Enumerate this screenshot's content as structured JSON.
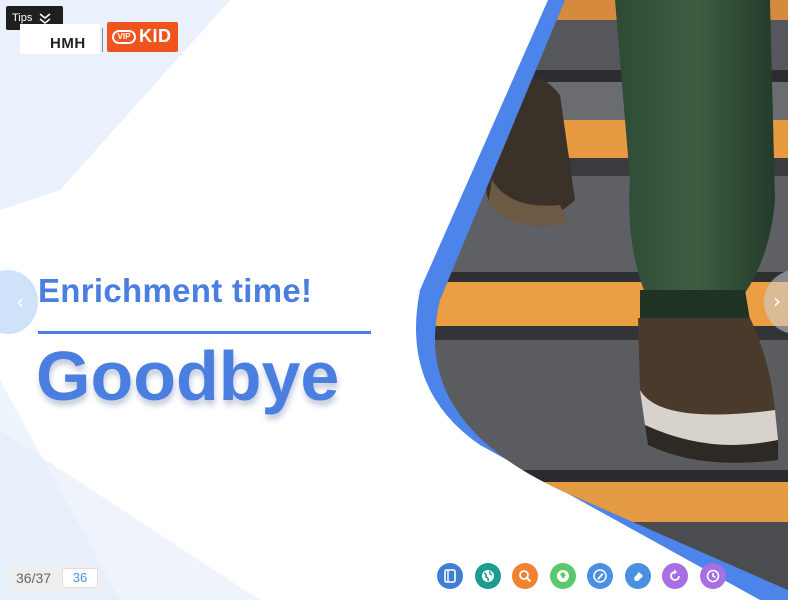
{
  "tips": {
    "label": "Tips"
  },
  "logos": {
    "hmh": "HMH",
    "vip": "VIP",
    "kid": "KID"
  },
  "slide": {
    "subtitle": "Enrichment time!",
    "title": "Goodbye"
  },
  "pagination": {
    "count": "36/37",
    "current": "36"
  },
  "toolbar": {
    "tools": [
      {
        "icon": "book-icon",
        "color": "#3f7fd6"
      },
      {
        "icon": "globe-icon",
        "color": "#1b9c8c"
      },
      {
        "icon": "search-icon",
        "color": "#f08232"
      },
      {
        "icon": "tag-icon",
        "color": "#5cc86e"
      },
      {
        "icon": "pen-icon",
        "color": "#4a90e2"
      },
      {
        "icon": "eraser-icon",
        "color": "#4a90e2"
      },
      {
        "icon": "refresh-icon",
        "color": "#a76fe3"
      },
      {
        "icon": "clock-icon",
        "color": "#a76fe3"
      }
    ]
  },
  "colors": {
    "accent": "#4a7fdf",
    "brand": "#f0541e"
  }
}
